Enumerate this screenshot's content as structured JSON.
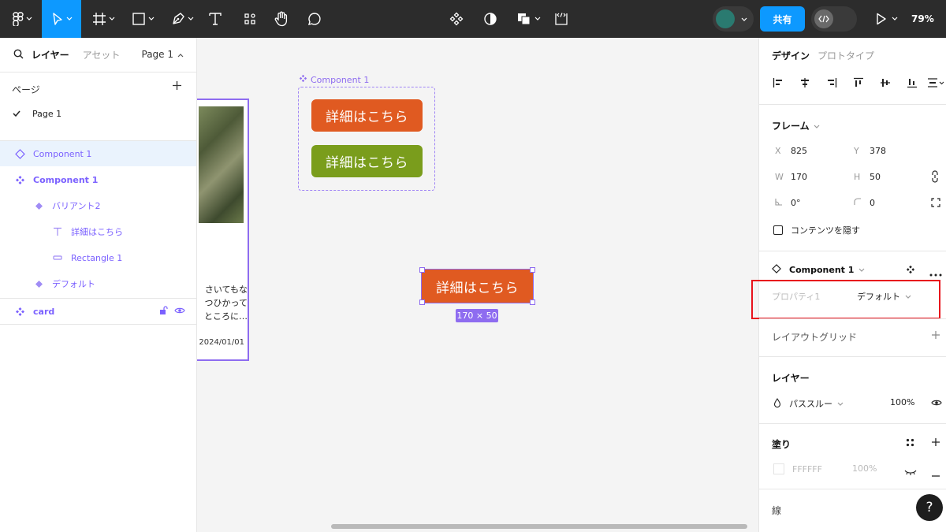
{
  "toolbar": {
    "share_label": "共有",
    "zoom": "79%",
    "icons": [
      "figma-logo-icon",
      "move-tool-icon",
      "frame-tool-icon",
      "rectangle-tool-icon",
      "pen-tool-icon",
      "text-tool-icon",
      "actions-icon",
      "hand-tool-icon",
      "comment-tool-icon",
      "component-icon",
      "mask-icon",
      "boolean-icon",
      "dev-mode-icon",
      "play-icon"
    ]
  },
  "left_panel": {
    "tabs": {
      "layers": "レイヤー",
      "assets": "アセット"
    },
    "page_selector": "Page 1",
    "pages_title": "ページ",
    "pages": [
      "Page 1"
    ],
    "layers": [
      {
        "label": "Component 1",
        "icon": "component-set-icon",
        "selected": true
      },
      {
        "label": "Component 1",
        "icon": "component-icon"
      },
      {
        "label": "バリアント2",
        "icon": "variant-icon"
      },
      {
        "label": "詳細はこちら",
        "icon": "text-layer-icon"
      },
      {
        "label": "Rectangle 1",
        "icon": "rectangle-layer-icon"
      },
      {
        "label": "デフォルト",
        "icon": "variant-icon"
      },
      {
        "label": "card",
        "icon": "component-icon"
      }
    ]
  },
  "canvas": {
    "component_label": "Component 1",
    "button_text": "詳細はこちら",
    "size_badge": "170 × 50",
    "card": {
      "text_lines": [
        "さいてもな",
        "つひかって",
        "ところに…"
      ],
      "date": "2024/01/01"
    },
    "colors": {
      "orange": "#e05a21",
      "green": "#7a9d1c",
      "selection": "#8e6cf0"
    }
  },
  "right_panel": {
    "tabs": {
      "design": "デザイン",
      "prototype": "プロトタイプ"
    },
    "frame": {
      "title": "フレーム",
      "x_label": "X",
      "x": "825",
      "y_label": "Y",
      "y": "378",
      "w_label": "W",
      "w": "170",
      "h_label": "H",
      "h": "50",
      "rotation": "0°",
      "radius": "0",
      "clip_label": "コンテンツを隠す"
    },
    "component": {
      "title": "Component 1",
      "property_label": "プロパティ1",
      "property_value": "デフォルト"
    },
    "layout_grid": "レイアウトグリッド",
    "layer": {
      "title": "レイヤー",
      "blend": "パススルー",
      "opacity": "100%"
    },
    "fill": {
      "title": "塗り",
      "hex": "FFFFFF",
      "opacity": "100%"
    },
    "stroke": {
      "title": "線"
    },
    "help": "?"
  }
}
